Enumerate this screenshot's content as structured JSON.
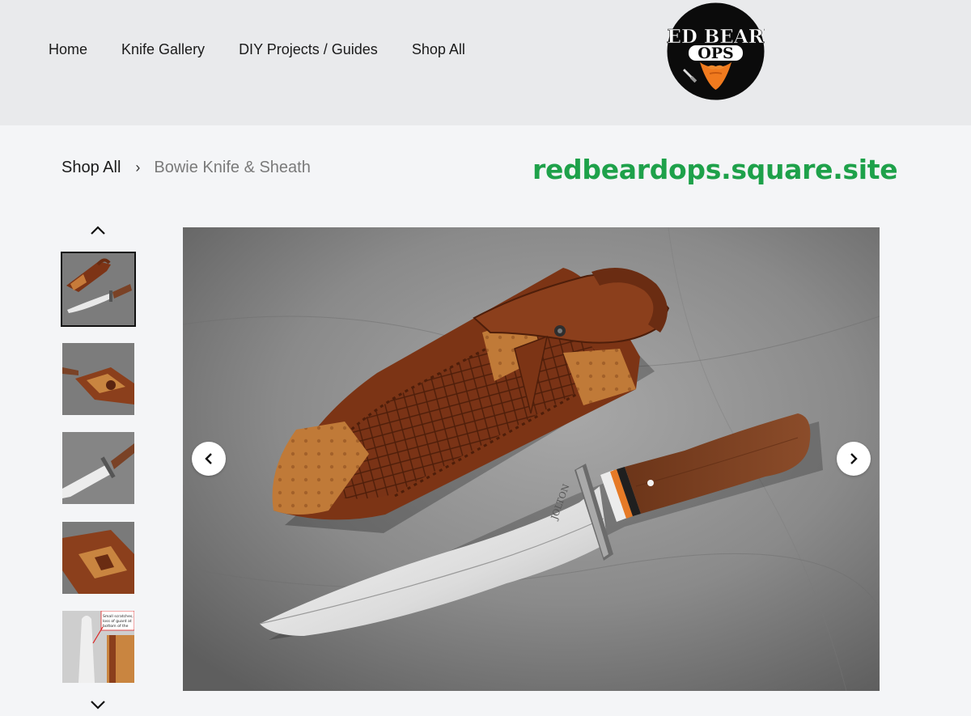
{
  "nav": {
    "items": [
      "Home",
      "Knife Gallery",
      "DIY Projects / Guides",
      "Shop All"
    ]
  },
  "logo": {
    "line1": "RED BEARD",
    "line2": "OPS"
  },
  "breadcrumb": {
    "parent": "Shop All",
    "separator": "›",
    "current": "Bowie Knife & Sheath"
  },
  "site_url": "redbeardops.square.site",
  "gallery": {
    "thumbnails": [
      {
        "name": "knife-and-sheath-overview",
        "active": true
      },
      {
        "name": "sheath-closeup",
        "active": false
      },
      {
        "name": "blade-closeup",
        "active": false
      },
      {
        "name": "sheath-detail",
        "active": false
      },
      {
        "name": "annotated-detail",
        "active": false
      }
    ],
    "annotation_text": "Small scratches, loss of guard at bottom of the"
  },
  "colors": {
    "header_bg": "#e9eaec",
    "page_bg": "#f4f5f7",
    "url_green": "#1ea14a",
    "leather": "#8b3f1c",
    "ostrich": "#c98540",
    "handle": "#7a4226"
  },
  "icons": {
    "thumb_up": "chevron-up-icon",
    "thumb_down": "chevron-down-icon",
    "prev": "chevron-left-icon",
    "next": "chevron-right-icon"
  }
}
